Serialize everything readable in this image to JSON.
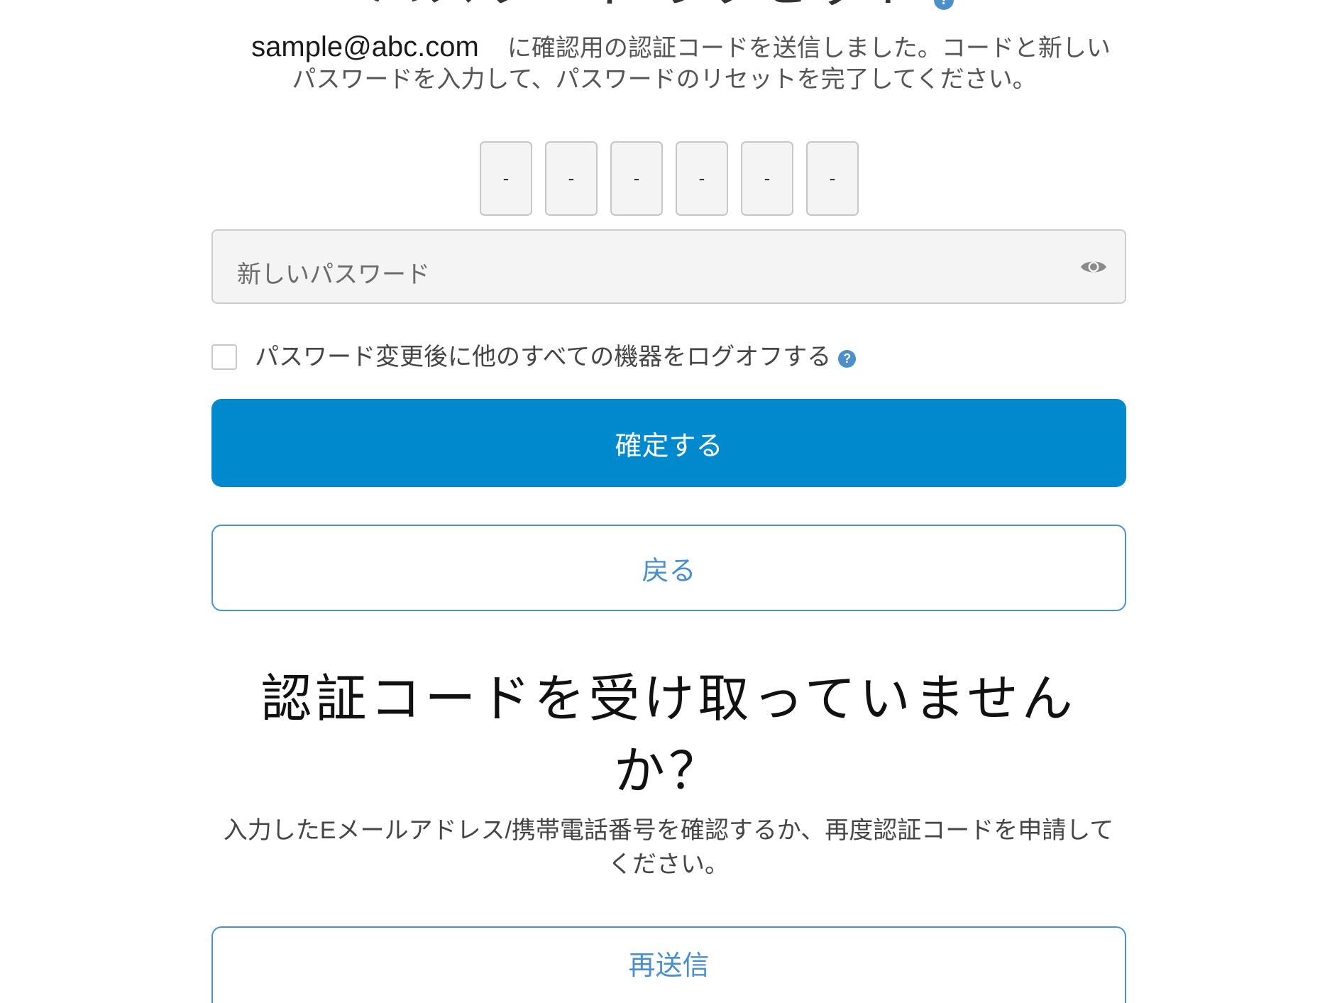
{
  "header": {
    "title": "パスワードのリセット"
  },
  "message": {
    "email": "sample@abc.com",
    "line1": "に確認用の認証コードを送信しました。コードと新しい",
    "line2": "パスワードを入力して、パスワードのリセットを完了してください。"
  },
  "code_inputs": {
    "placeholders": [
      "-",
      "-",
      "-",
      "-",
      "-",
      "-"
    ]
  },
  "password": {
    "placeholder": "新しいパスワード"
  },
  "logoff_checkbox": {
    "label": "パスワード変更後に他のすべての機器をログオフする",
    "checked": false
  },
  "buttons": {
    "confirm": "確定する",
    "back": "戻る",
    "resend": "再送信"
  },
  "resend_section": {
    "heading": "認証コードを受け取っていませんか？",
    "description": "入力したEメールアドレス/携帯電話番号を確認するか、再度認証コードを申請してください。"
  },
  "icons": {
    "help": "help-icon",
    "help_glyph": "?",
    "password_toggle": "eye-icon"
  },
  "colors": {
    "primary_button": "#0089cc",
    "outline_button": "#4b92d1",
    "help_icon": "#4c8fca",
    "input_background": "#f4f4f4"
  }
}
